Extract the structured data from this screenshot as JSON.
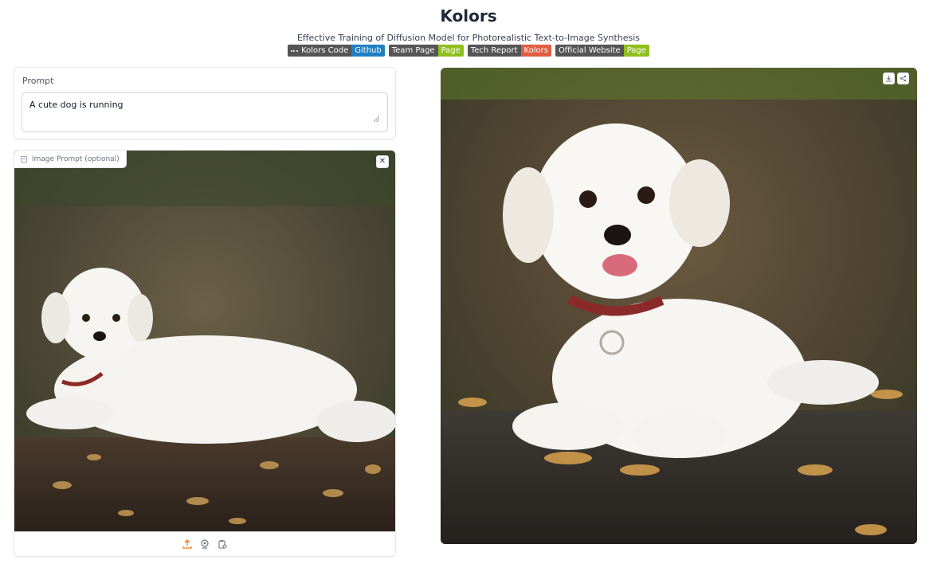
{
  "app": {
    "title": "Kolors",
    "subtitle": "Effective Training of Diffusion Model for Photorealistic Text-to-Image Synthesis"
  },
  "badges": [
    {
      "left": "Kolors Code",
      "right": "Github",
      "right_color": "#1f7fc2",
      "icon": "github-icon"
    },
    {
      "left": "Team Page",
      "right": "Page",
      "right_color": "#8fbf1e"
    },
    {
      "left": "Tech Report",
      "right": "Kolors",
      "right_color": "#e05d44"
    },
    {
      "left": "Official Website",
      "right": "Page",
      "right_color": "#8fbf1e"
    }
  ],
  "prompt": {
    "label": "Prompt",
    "value": "A cute dog is running"
  },
  "image_prompt": {
    "label": "Image Prompt (optional)",
    "clear_icon": "close-icon",
    "tools": [
      "upload-icon",
      "webcam-icon",
      "clipboard-icon"
    ]
  },
  "output": {
    "buttons": [
      "download-icon",
      "share-icon"
    ]
  },
  "colors": {
    "accent": "#f97316",
    "border": "#e5e7eb"
  }
}
